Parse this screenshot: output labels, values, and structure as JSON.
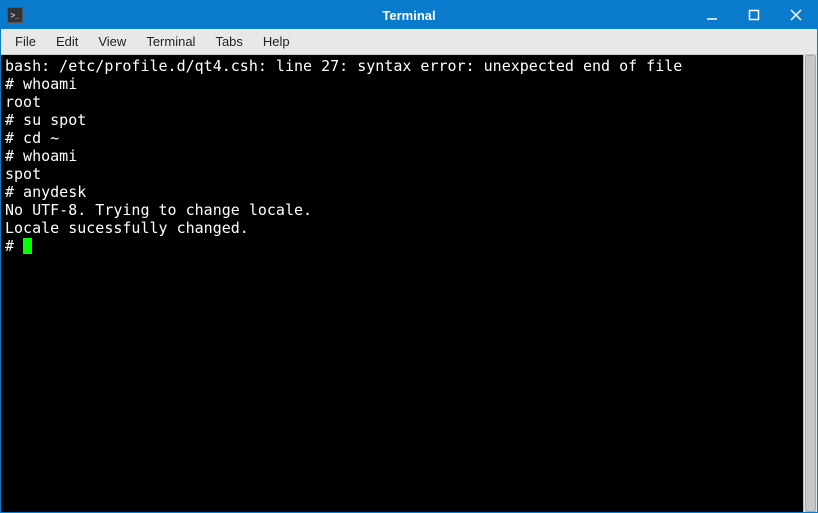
{
  "window": {
    "title": "Terminal"
  },
  "menubar": {
    "items": [
      "File",
      "Edit",
      "View",
      "Terminal",
      "Tabs",
      "Help"
    ]
  },
  "terminal": {
    "lines": [
      "bash: /etc/profile.d/qt4.csh: line 27: syntax error: unexpected end of file",
      "# whoami",
      "root",
      "# su spot",
      "# cd ~",
      "# whoami",
      "spot",
      "# anydesk",
      "No UTF-8. Trying to change locale.",
      "Locale sucessfully changed."
    ],
    "prompt": "# "
  }
}
